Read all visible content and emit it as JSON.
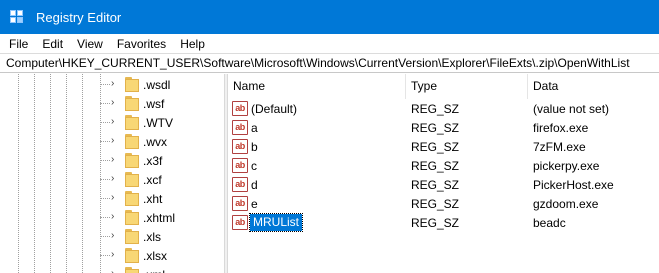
{
  "window": {
    "title": "Registry Editor"
  },
  "menu": [
    "File",
    "Edit",
    "View",
    "Favorites",
    "Help"
  ],
  "address": "Computer\\HKEY_CURRENT_USER\\Software\\Microsoft\\Windows\\CurrentVersion\\Explorer\\FileExts\\.zip\\OpenWithList",
  "tree": {
    "items": [
      ".wsdl",
      ".wsf",
      ".WTV",
      ".wvx",
      ".x3f",
      ".xcf",
      ".xht",
      ".xhtml",
      ".xls",
      ".xlsx",
      ".xml"
    ]
  },
  "list": {
    "columns": {
      "name": "Name",
      "type": "Type",
      "data": "Data"
    },
    "rows": [
      {
        "icon": "ab",
        "name": "(Default)",
        "type": "REG_SZ",
        "data": "(value not set)",
        "selected": false
      },
      {
        "icon": "ab",
        "name": "a",
        "type": "REG_SZ",
        "data": "firefox.exe",
        "selected": false
      },
      {
        "icon": "ab",
        "name": "b",
        "type": "REG_SZ",
        "data": "7zFM.exe",
        "selected": false
      },
      {
        "icon": "ab",
        "name": "c",
        "type": "REG_SZ",
        "data": "pickerpy.exe",
        "selected": false
      },
      {
        "icon": "ab",
        "name": "d",
        "type": "REG_SZ",
        "data": "PickerHost.exe",
        "selected": false
      },
      {
        "icon": "ab",
        "name": "e",
        "type": "REG_SZ",
        "data": "gzdoom.exe",
        "selected": false
      },
      {
        "icon": "ab",
        "name": "MRUList",
        "type": "REG_SZ",
        "data": "beadc",
        "selected": true
      }
    ]
  },
  "icons": {
    "app": "registry-editor-icon",
    "folder": "folder-icon",
    "expand": "chevron-right-icon",
    "value": "string-value-icon"
  },
  "colors": {
    "titlebar": "#0078d7",
    "selection": "#0078d7",
    "folder": "#f8d775"
  }
}
